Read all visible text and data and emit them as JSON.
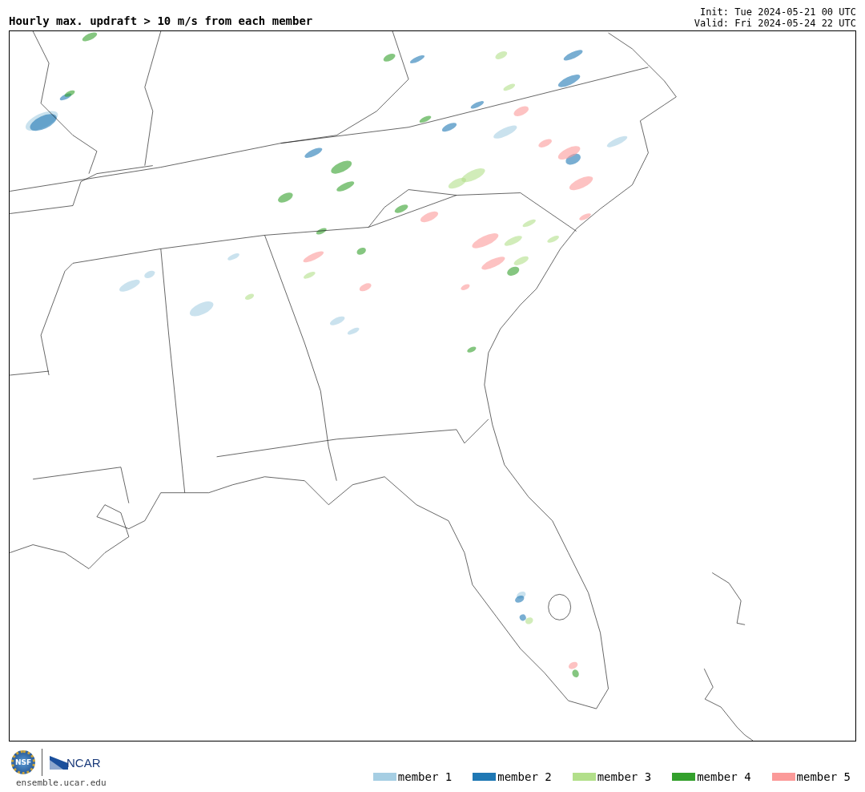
{
  "title": "Hourly max. updraft > 10 m/s from each member",
  "run_info": [
    "Init: Tue 2024-05-21 00 UTC",
    "Valid: Fri 2024-05-24 22 UTC"
  ],
  "logos": {
    "nsf": "NSF",
    "ncar": "NCAR",
    "site": "ensemble.ucar.edu"
  },
  "legend": [
    {
      "label": "member 1",
      "color": "#a6cee3"
    },
    {
      "label": "member 2",
      "color": "#1f78b4"
    },
    {
      "label": "member 3",
      "color": "#b2df8a"
    },
    {
      "label": "member 4",
      "color": "#33a02c"
    },
    {
      "label": "member 5",
      "color": "#fb9a99"
    }
  ]
}
